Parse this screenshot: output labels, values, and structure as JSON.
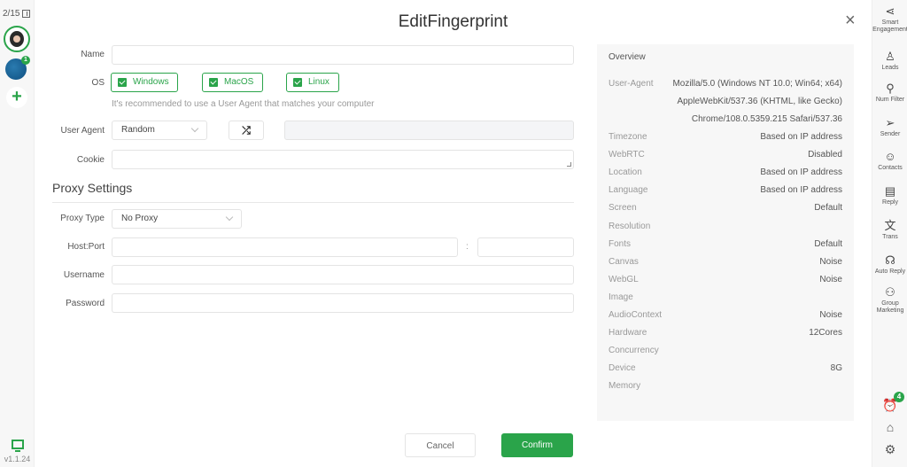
{
  "left_bar": {
    "account_count": "2/15",
    "version": "v1.1.24",
    "avatar2_badge": "1",
    "add_label": "+"
  },
  "dialog": {
    "title": "EditFingerprint",
    "close_icon": "×",
    "name": {
      "label": "Name",
      "value": ""
    },
    "os": {
      "label": "OS",
      "options": [
        {
          "label": "Windows",
          "checked": true
        },
        {
          "label": "MacOS",
          "checked": true
        },
        {
          "label": "Linux",
          "checked": true
        }
      ],
      "hint": "It's recommended to use a User Agent that matches your computer"
    },
    "user_agent": {
      "label": "User Agent",
      "selected": "Random",
      "shuffle_icon": "⤮",
      "value": ""
    },
    "cookie": {
      "label": "Cookie",
      "value": ""
    },
    "proxy": {
      "section_title": "Proxy Settings",
      "type_label": "Proxy Type",
      "type_selected": "No Proxy",
      "host_label": "Host:Port",
      "host_value": "",
      "colon": ":",
      "port_value": "",
      "username_label": "Username",
      "username_value": "",
      "password_label": "Password",
      "password_value": ""
    },
    "overview": {
      "title": "Overview",
      "user_agent_label": "User-Agent",
      "user_agent_lines": [
        "Mozilla/5.0 (Windows NT 10.0; Win64; x64)",
        "AppleWebKit/537.36 (KHTML, like Gecko)",
        "Chrome/108.0.5359.215 Safari/537.36"
      ],
      "rows": [
        {
          "key": "Timezone",
          "value": "Based on IP address"
        },
        {
          "key": "WebRTC",
          "value": "Disabled"
        },
        {
          "key": "Location",
          "value": "Based on IP address"
        },
        {
          "key": "Language",
          "value": "Based on IP address"
        },
        {
          "key": "Screen",
          "value": "Default"
        },
        {
          "key": "Resolution",
          "value": ""
        },
        {
          "key": "Fonts",
          "value": "Default"
        },
        {
          "key": "Canvas",
          "value": "Noise"
        },
        {
          "key": "WebGL",
          "value": "Noise"
        },
        {
          "key": "Image",
          "value": ""
        },
        {
          "key": "AudioContext",
          "value": "Noise"
        },
        {
          "key": "Hardware",
          "value": "12Cores"
        },
        {
          "key": "Concurrency",
          "value": ""
        },
        {
          "key": "Device",
          "value": "8G"
        },
        {
          "key": "Memory",
          "value": ""
        }
      ]
    },
    "cancel_label": "Cancel",
    "confirm_label": "Confirm"
  },
  "right_bar": {
    "items": [
      {
        "label": "Smart Engagement",
        "icon": "share-icon",
        "glyph": "⋖"
      },
      {
        "label": "Leads",
        "icon": "leads-icon",
        "glyph": "♙"
      },
      {
        "label": "Num Filter",
        "icon": "num-filter-icon",
        "glyph": "⚲"
      },
      {
        "label": "Sender",
        "icon": "send-icon",
        "glyph": "➢"
      },
      {
        "label": "Contacts",
        "icon": "contacts-icon",
        "glyph": "☺"
      },
      {
        "label": "Reply",
        "icon": "reply-icon",
        "glyph": "▤"
      },
      {
        "label": "Trans",
        "icon": "translate-icon",
        "glyph": "文"
      },
      {
        "label": "Auto Reply",
        "icon": "headset-icon",
        "glyph": "☊"
      },
      {
        "label": "Group Marketing",
        "icon": "group-icon",
        "glyph": "⚇"
      }
    ],
    "alarm_badge": "4",
    "alarm_glyph": "⏰",
    "store_glyph": "⌂",
    "settings_glyph": "⚙"
  },
  "colors": {
    "accent": "#2aa44a"
  }
}
